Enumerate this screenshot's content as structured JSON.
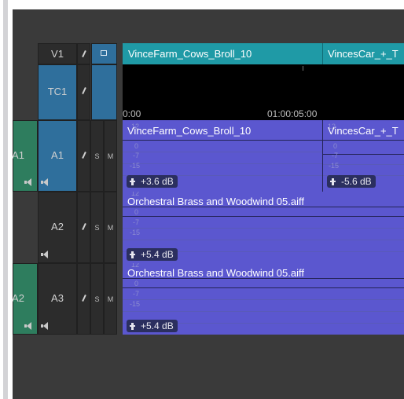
{
  "header": {
    "video_track_label": "V1",
    "timecode_track_label": "TC1",
    "timecode_ruler": {
      "start": "0:00",
      "mark": "01:00:05:00"
    },
    "video_clips": [
      {
        "name": "VinceFarm_Cows_Broll_10"
      },
      {
        "name": "VincesCar_+_T"
      }
    ]
  },
  "tracks": [
    {
      "source_label": "A1",
      "record_label": "A1",
      "solo_label": "S",
      "mute_label": "M",
      "clips": [
        {
          "name": "VinceFarm_Cows_Broll_10",
          "gain": "+3.6 dB",
          "scale": [
            "12",
            "0",
            "-7",
            "-15"
          ]
        },
        {
          "name": "VincesCar_+_T",
          "gain": "-5.6 dB",
          "scale": [
            "12",
            "0",
            "-7",
            "-15"
          ]
        }
      ]
    },
    {
      "source_label": "",
      "record_label": "A2",
      "solo_label": "S",
      "mute_label": "M",
      "clips": [
        {
          "name": "Orchestral Brass and Woodwind 05.aiff",
          "gain": "+5.4 dB",
          "scale": [
            "12",
            "0",
            "-7",
            "-15"
          ]
        }
      ]
    },
    {
      "source_label": "A2",
      "record_label": "A3",
      "solo_label": "S",
      "mute_label": "M",
      "clips": [
        {
          "name": "Orchestral Brass and Woodwind 05.aiff",
          "gain": "+5.4 dB",
          "scale": [
            "12",
            "0",
            "-7",
            "-15"
          ]
        }
      ]
    }
  ],
  "colors": {
    "panel_bg": "#3a3a3a",
    "video_clip": "#1f9aa6",
    "audio_clip": "#5b57cf",
    "source_patch": "#2e7d5e",
    "record_patch": "#2f6f9c"
  },
  "icons": [
    "pencil-icon",
    "monitor-icon",
    "speaker-icon",
    "keyframe-pin-icon"
  ]
}
